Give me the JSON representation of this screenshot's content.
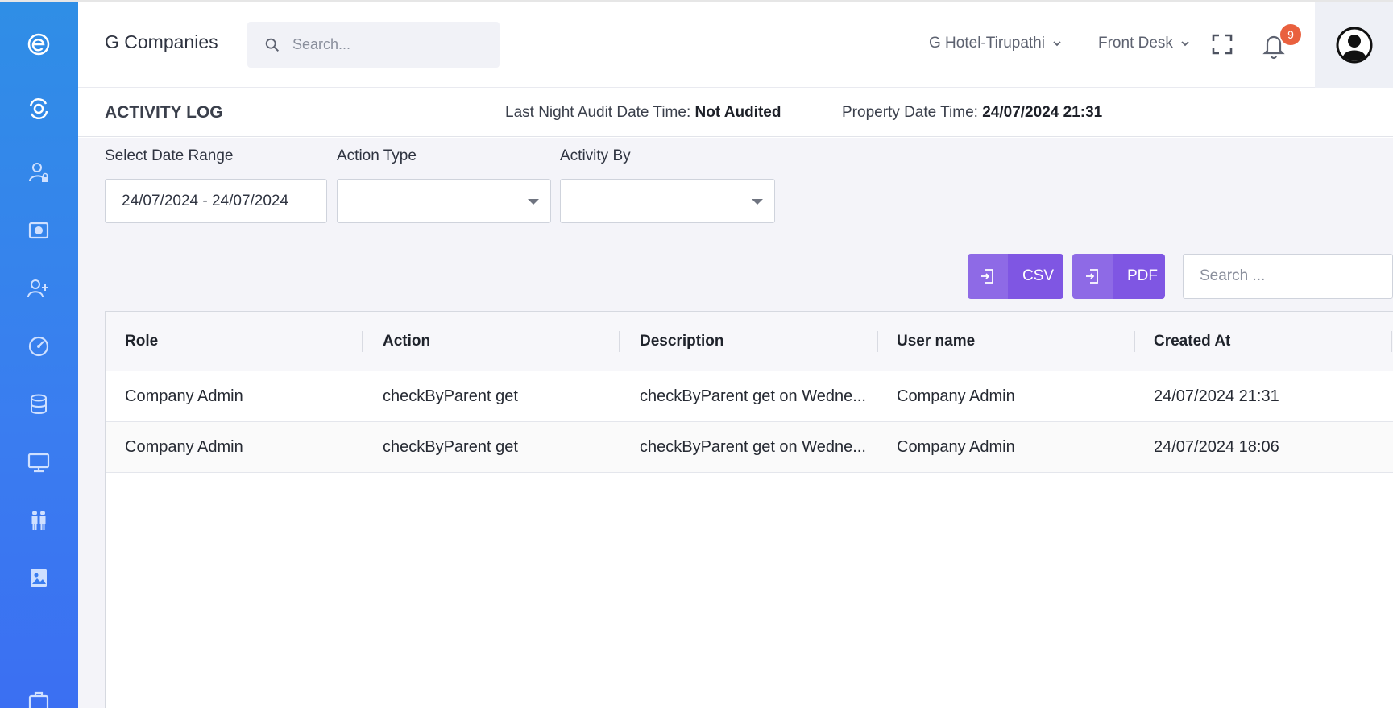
{
  "brand": "G Companies",
  "header": {
    "search_placeholder": "Search...",
    "hotel_select": "G Hotel-Tirupathi",
    "role_select": "Front Desk",
    "notification_count": "9"
  },
  "subheader": {
    "title": "ACTIVITY LOG",
    "audit_label": "Last Night Audit Date Time:",
    "audit_value": "Not Audited",
    "property_label": "Property Date Time:",
    "property_value": "24/07/2024 21:31"
  },
  "filters": {
    "date_range_label": "Select Date Range",
    "date_range_value": "24/07/2024 - 24/07/2024",
    "action_type_label": "Action Type",
    "action_type_value": "",
    "activity_by_label": "Activity By",
    "activity_by_value": ""
  },
  "toolbar": {
    "csv_label": "CSV",
    "pdf_label": "PDF",
    "search_placeholder": "Search ..."
  },
  "table": {
    "columns": [
      "Role",
      "Action",
      "Description",
      "User name",
      "Created At"
    ],
    "rows": [
      [
        "Company Admin",
        "checkByParent get",
        "checkByParent get on Wedne...",
        "Company Admin",
        "24/07/2024 21:31"
      ],
      [
        "Company Admin",
        "checkByParent get",
        "checkByParent get on Wedne...",
        "Company Admin",
        "24/07/2024 18:06"
      ]
    ]
  },
  "sidebar": {
    "icons": [
      "logo-icon",
      "dashboard-icon",
      "user-lock-icon",
      "camera-icon",
      "add-user-icon",
      "speedometer-icon",
      "database-icon",
      "monitor-icon",
      "people-icon",
      "gallery-icon",
      "briefcase-icon"
    ]
  },
  "colors": {
    "accent": "#7f56e3",
    "sidebar_top": "#2f8ee6",
    "sidebar_bottom": "#3b6ff2",
    "badge": "#e9603e"
  }
}
